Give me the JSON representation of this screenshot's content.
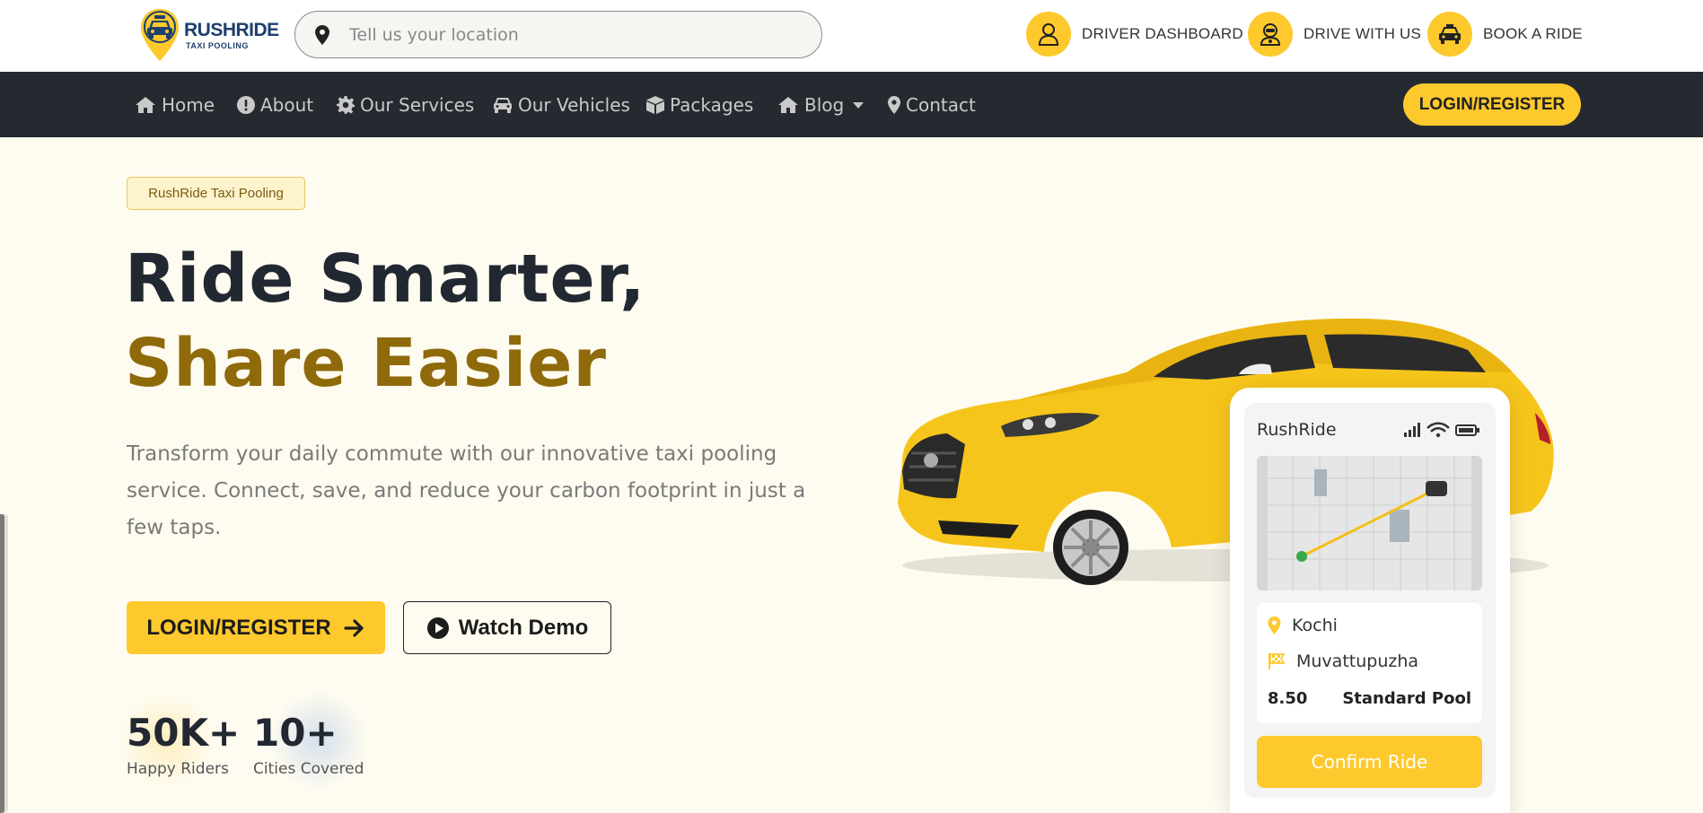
{
  "brand": {
    "name": "RUSHRIDE",
    "tagline": "TAXI POOLING"
  },
  "search": {
    "placeholder": "Tell us your location"
  },
  "top_actions": [
    {
      "label": "DRIVER DASHBOARD",
      "icon": "user-icon"
    },
    {
      "label": "DRIVE WITH US",
      "icon": "driver-icon"
    },
    {
      "label": "BOOK A RIDE",
      "icon": "taxi-icon"
    }
  ],
  "nav": {
    "items": [
      {
        "label": "Home",
        "icon": "home-icon"
      },
      {
        "label": "About",
        "icon": "info-icon"
      },
      {
        "label": "Our Services",
        "icon": "gear-icon"
      },
      {
        "label": "Our Vehicles",
        "icon": "car-icon"
      },
      {
        "label": "Packages",
        "icon": "box-icon"
      },
      {
        "label": "Blog",
        "icon": "home-icon",
        "dropdown": true
      },
      {
        "label": "Contact",
        "icon": "map-pin-icon"
      }
    ],
    "login_label": "LOGIN/REGISTER"
  },
  "hero": {
    "badge": "RushRide Taxi Pooling",
    "headline_line1": "Ride Smarter,",
    "headline_line2": "Share Easier",
    "description": "Transform your daily commute with our innovative taxi pooling service. Connect, save, and reduce your carbon footprint in just a few taps.",
    "login_button": "LOGIN/REGISTER",
    "demo_button": "Watch Demo",
    "stats": [
      {
        "value": "50K+",
        "label": "Happy Riders"
      },
      {
        "value": "10+",
        "label": "Cities Covered"
      }
    ]
  },
  "phone": {
    "app_name": "RushRide",
    "pickup": "Kochi",
    "destination": "Muvattupuzha",
    "fare": "8.50",
    "ride_type": "Standard Pool",
    "confirm_label": "Confirm Ride"
  },
  "colors": {
    "accent": "#fdc92d",
    "nav_bg": "#252a30",
    "headline_dark": "#222831",
    "headline_gold": "#8f6a0b",
    "page_bg": "#fefbf0"
  }
}
